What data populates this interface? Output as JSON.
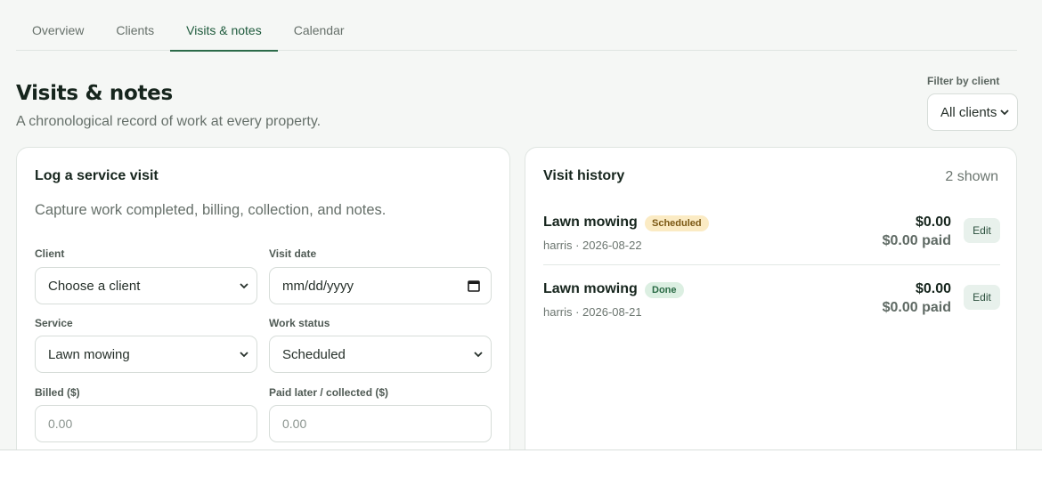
{
  "tabs": [
    {
      "label": "Overview"
    },
    {
      "label": "Clients"
    },
    {
      "label": "Visits & notes"
    },
    {
      "label": "Calendar"
    }
  ],
  "header": {
    "title": "Visits & notes",
    "subtitle": "A chronological record of work at every property."
  },
  "filter": {
    "label": "Filter by client",
    "value": "All clients"
  },
  "log_form": {
    "title": "Log a service visit",
    "description": "Capture work completed, billing, collection, and notes.",
    "client_label": "Client",
    "client_value": "Choose a client",
    "date_label": "Visit date",
    "date_placeholder": "mm/dd/yyyy",
    "service_label": "Service",
    "service_value": "Lawn mowing",
    "status_label": "Work status",
    "status_value": "Scheduled",
    "billed_label": "Billed ($)",
    "billed_placeholder": "0.00",
    "paid_label": "Paid later / collected ($)",
    "paid_placeholder": "0.00"
  },
  "history": {
    "title": "Visit history",
    "count": "2 shown",
    "visits": [
      {
        "service": "Lawn mowing",
        "status": "Scheduled",
        "meta": "harris · 2026-08-22",
        "billed": "$0.00",
        "paid": "$0.00 paid",
        "edit": "Edit"
      },
      {
        "service": "Lawn mowing",
        "status": "Done",
        "meta": "harris · 2026-08-21",
        "billed": "$0.00",
        "paid": "$0.00 paid",
        "edit": "Edit"
      }
    ]
  },
  "colors": {
    "accent": "#2c6b49",
    "scheduled_badge": "#fbebc4",
    "done_badge": "#dcefe2"
  }
}
